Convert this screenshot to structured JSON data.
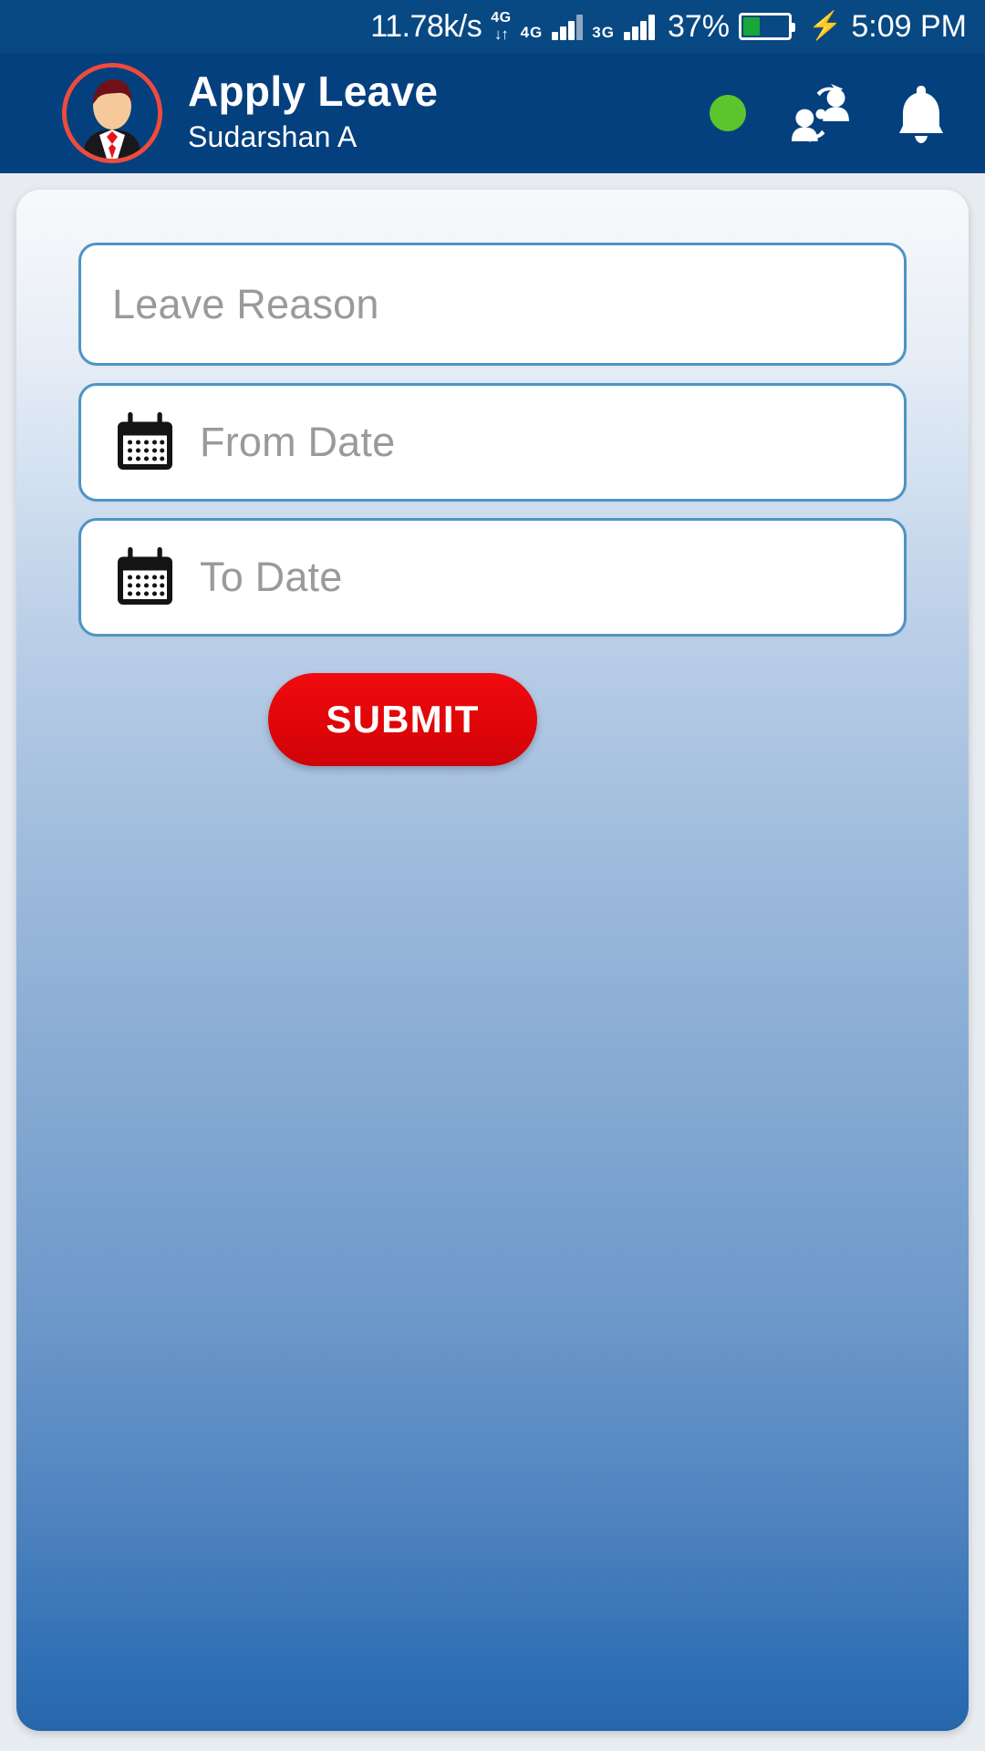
{
  "status_bar": {
    "network_speed": "11.78k/s",
    "data_transfer_label": "4G",
    "data_transfer_arrows": "↓↑",
    "sim2_label": "3G",
    "battery_percent_label": "37%",
    "battery_level": 37,
    "charging_icon": "⚡",
    "time": "5:09 PM",
    "battery_fill_color": "#17a637",
    "background_color": "#084883"
  },
  "header": {
    "title": "Apply Leave",
    "subtitle": "Sudarshan A",
    "avatar_name": "user-avatar",
    "status_dot_color": "#5cc42c",
    "switch_user_icon": "switch-user-icon",
    "notification_icon": "bell-icon",
    "background_color": "#04407e"
  },
  "form": {
    "leave_reason": {
      "value": "",
      "placeholder": "Leave Reason"
    },
    "from_date": {
      "value": "",
      "placeholder": "From Date",
      "icon": "calendar-icon"
    },
    "to_date": {
      "value": "",
      "placeholder": "To Date",
      "icon": "calendar-icon"
    },
    "submit_label": "SUBMIT",
    "submit_color": "#e00509",
    "field_border_color": "#4e94c4"
  }
}
